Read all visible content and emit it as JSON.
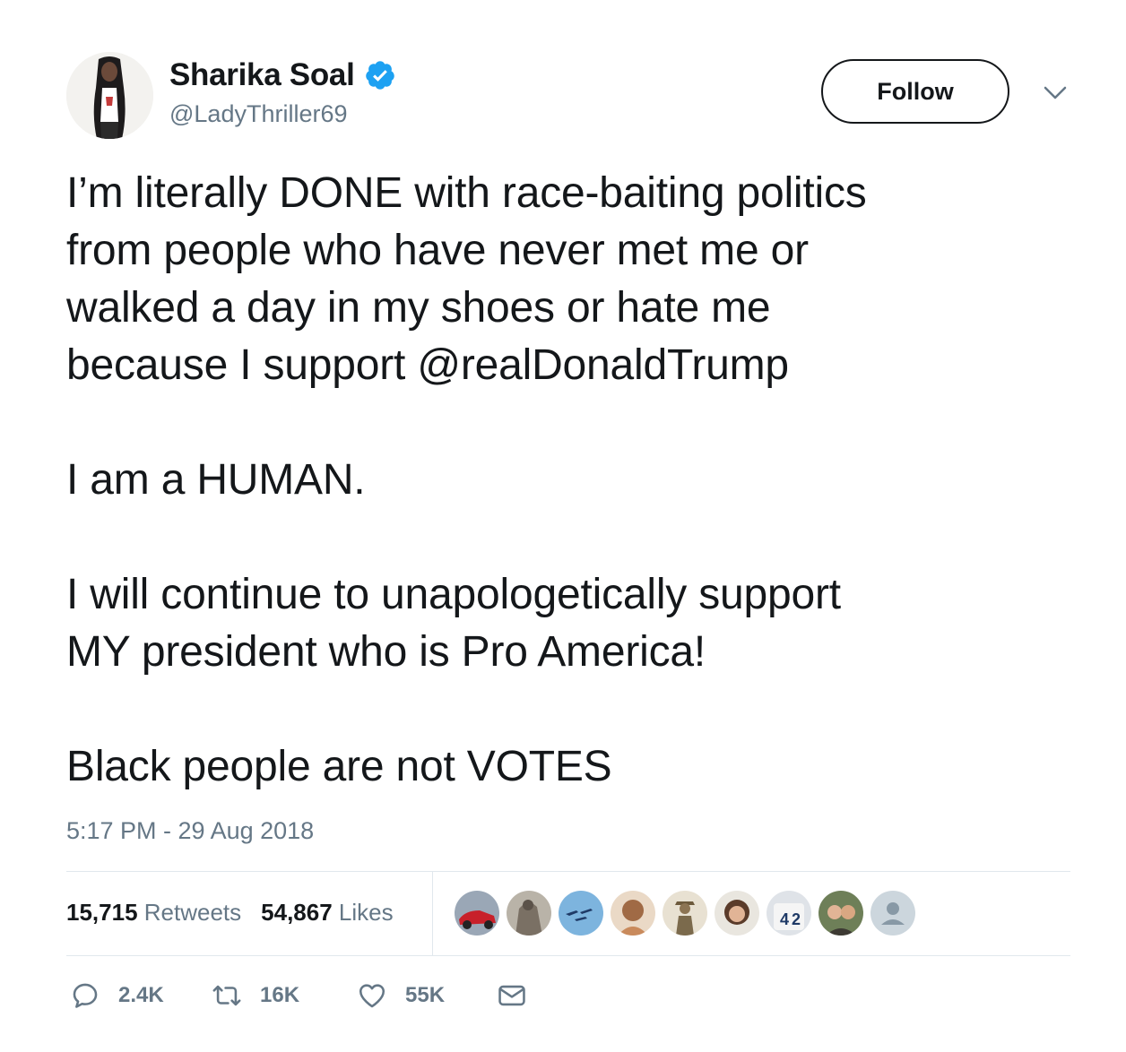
{
  "user": {
    "display_name": "Sharika Soal",
    "handle": "@LadyThriller69",
    "verified": true
  },
  "header": {
    "follow_label": "Follow"
  },
  "tweet": {
    "text_part1": "I’m literally DONE with race-baiting politics\nfrom people who have never met me or\nwalked a day in my shoes or hate me\nbecause I support ",
    "mention": "@realDonaldTrump",
    "text_part2": "\n\nI am a HUMAN.\n\nI will continue to unapologetically support\nMY president who is Pro America!\n\nBlack people are not VOTES",
    "timestamp": "5:17 PM - 29 Aug 2018"
  },
  "stats": {
    "retweets_count": "15,715",
    "retweets_label": "Retweets",
    "likes_count": "54,867",
    "likes_label": "Likes"
  },
  "actions": {
    "reply_count": "2.4K",
    "retweet_count": "16K",
    "like_count": "55K"
  },
  "colors": {
    "verified_blue": "#1da1f2",
    "secondary_text": "#657786",
    "divider": "#e1e8ed"
  },
  "icons": {
    "verified": "verified-badge-icon",
    "caret": "chevron-down-icon",
    "reply": "reply-icon",
    "retweet": "retweet-icon",
    "like": "heart-icon",
    "dm": "envelope-icon"
  }
}
